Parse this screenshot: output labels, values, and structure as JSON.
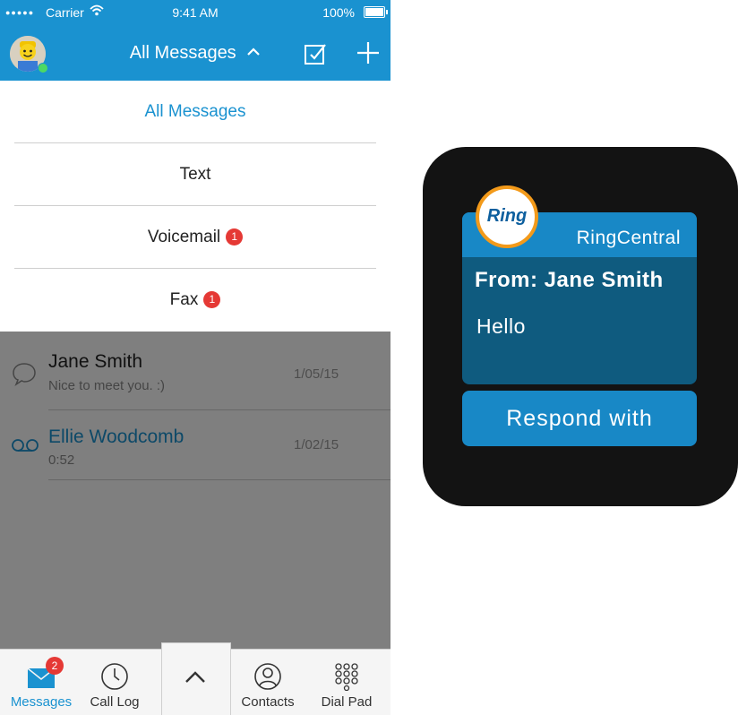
{
  "status_bar": {
    "carrier": "Carrier",
    "time": "9:41 AM",
    "battery": "100%"
  },
  "nav": {
    "title": "All Messages"
  },
  "dropdown": [
    {
      "label": "All Messages",
      "active": true,
      "badge": ""
    },
    {
      "label": "Text",
      "active": false,
      "badge": ""
    },
    {
      "label": "Voicemail",
      "active": false,
      "badge": "1"
    },
    {
      "label": "Fax",
      "active": false,
      "badge": "1"
    }
  ],
  "messages": [
    {
      "name": "Jane Smith",
      "snippet": "Nice to meet you. :)",
      "date": "1/05/15",
      "icon": "chat-bubble-icon",
      "unread": false
    },
    {
      "name": "Ellie Woodcomb",
      "snippet": "0:52",
      "date": "1/02/15",
      "icon": "voicemail-icon",
      "unread": true
    }
  ],
  "tabs": [
    {
      "label": "Messages",
      "icon": "envelope-icon",
      "badge": "2",
      "active": true
    },
    {
      "label": "Call Log",
      "icon": "clock-icon",
      "badge": "",
      "active": false
    },
    {
      "label": "",
      "icon": "chevron-up-icon",
      "badge": "",
      "active": false
    },
    {
      "label": "Contacts",
      "icon": "contact-icon",
      "badge": "",
      "active": false
    },
    {
      "label": "Dial Pad",
      "icon": "dialpad-icon",
      "badge": "",
      "active": false
    }
  ],
  "watch": {
    "logo_text": "Ring",
    "app_name": "RingCentral",
    "from": "From: Jane Smith",
    "message": "Hello",
    "respond_label": "Respond with"
  },
  "colors": {
    "brand_blue": "#1a92d0",
    "badge_red": "#e53935",
    "logo_orange": "#f39a1a",
    "watch_card": "#0f5b7f"
  }
}
